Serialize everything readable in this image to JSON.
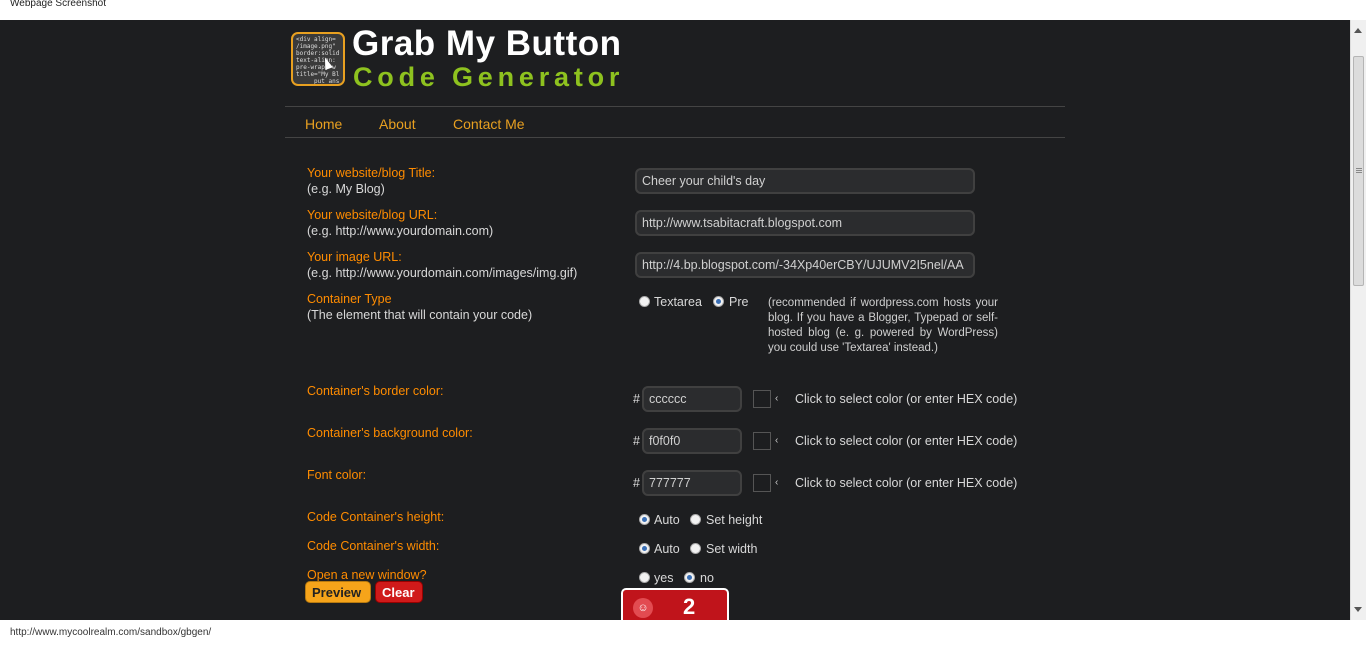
{
  "window": {
    "caption": "Webpage Screenshot"
  },
  "header": {
    "title": "Grab My Button",
    "subtitle": "Code Generator",
    "logo_code": "<div align=\n/image.png\"\nborder:solid\ntext-align:\npre-wrap; w\ntitle=\"My Bl\n     put ans"
  },
  "nav": {
    "items": [
      "Home",
      "About",
      "Contact Me"
    ]
  },
  "form": {
    "title": {
      "label": "Your website/blog Title:",
      "hint": "(e.g. My Blog)",
      "value": "Cheer your child's day"
    },
    "url": {
      "label": "Your website/blog URL:",
      "hint": "(e.g. http://www.yourdomain.com)",
      "value": "http://www.tsabitacraft.blogspot.com"
    },
    "image": {
      "label": "Your image URL:",
      "hint": "(e.g. http://www.yourdomain.com/images/img.gif)",
      "value": "http://4.bp.blogspot.com/-34Xp40erCBY/UJUMV2I5nel/AA"
    },
    "container": {
      "label": "Container Type",
      "hint": "(The element that will contain your code)",
      "options": [
        "Textarea",
        "Pre"
      ],
      "selected": "Pre",
      "note": "(recommended if wordpress.com hosts your blog. If you have a Blogger, Typepad or self-hosted blog (e. g. powered by WordPress) you could use 'Textarea' instead.)"
    },
    "border_color": {
      "label": "Container's border color:",
      "value": "cccccc"
    },
    "bg_color": {
      "label": "Container's background color:",
      "value": "f0f0f0"
    },
    "font_color": {
      "label": "Font color:",
      "value": "777777"
    },
    "color_hint": "Click to select color (or enter HEX code)",
    "hash": "#",
    "height": {
      "label": "Code Container's height:",
      "options": [
        "Auto",
        "Set height"
      ],
      "selected": "Auto"
    },
    "width": {
      "label": "Code Container's width:",
      "options": [
        "Auto",
        "Set width"
      ],
      "selected": "Auto"
    },
    "new_window": {
      "label": "Open a new window?",
      "options": [
        "yes",
        "no"
      ],
      "selected": "no"
    }
  },
  "buttons": {
    "preview": "Preview",
    "clear": "Clear"
  },
  "badge": {
    "count": "2"
  },
  "status": {
    "url": "http://www.mycoolrealm.com/sandbox/gbgen/"
  },
  "colors": {
    "page_bg": "#1d1e20",
    "label": "#ff8c00",
    "accent": "#e8a020",
    "title_green": "#8ec21f",
    "clear": "#d01a1a"
  }
}
